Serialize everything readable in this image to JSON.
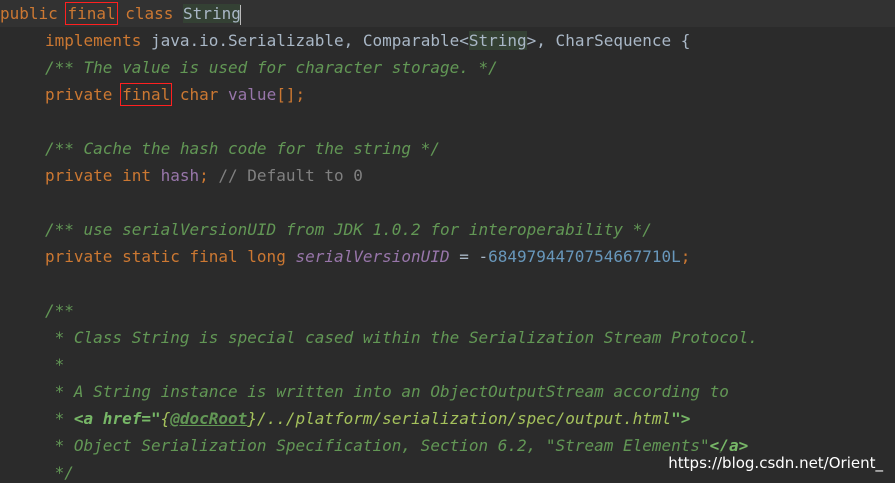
{
  "code": {
    "l1": {
      "public": "public ",
      "final": "final",
      "sp": " ",
      "class": "class ",
      "name": "String"
    },
    "l2": {
      "implements": "implements ",
      "iface1": "java.io.Serializable, Comparable<",
      "generic": "String",
      "iface2": ">, CharSequence {"
    },
    "l3": {
      "comment": "/** The value is used for character storage. */"
    },
    "l4": {
      "private": "private ",
      "final": "final",
      "rest_kw": " char ",
      "field": "value",
      "rest": "[];"
    },
    "l6": {
      "comment": "/** Cache the hash code for the string */"
    },
    "l7": {
      "private": "private int ",
      "field": "hash",
      "semi": ";",
      "comment": " // Default to 0"
    },
    "l9": {
      "comment": "/** use serialVersionUID from JDK 1.0.2 for interoperability */"
    },
    "l10": {
      "kws": "private static final long ",
      "field": "serialVersionUID",
      "eq": " = -",
      "num": "6849794470754667710L",
      "semi": ";"
    },
    "l12": {
      "comment": "/**"
    },
    "l13": {
      "comment": " * Class String is special cased within the Serialization Stream Protocol."
    },
    "l14": {
      "comment": " *"
    },
    "l15": {
      "comment": " * A String instance is written into an ObjectOutputStream according to"
    },
    "l16": {
      "star": " * ",
      "a_open": "<a href=\"",
      "brace_open": "{",
      "tag": "@docRoot",
      "brace_close": "}",
      "path": "/../platform/serialization/spec/output.html",
      "a_close_q": "\">"
    },
    "l17": {
      "text": " * Object Serialization Specification, Section 6.2, \"Stream Elements\"",
      "a_end": "</a>"
    },
    "l18": {
      "comment": " */"
    }
  },
  "watermark": "https://blog.csdn.net/Orient_"
}
